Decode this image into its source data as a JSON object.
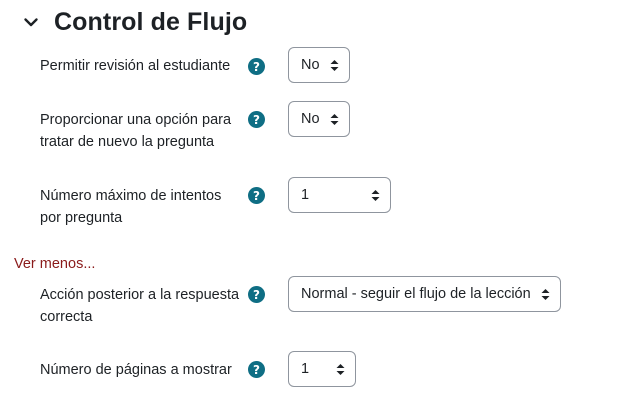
{
  "section": {
    "title": "Control de Flujo",
    "collapse_icon": "chevron-down-icon"
  },
  "fields": [
    {
      "label": "Permitir revisión al estudiante",
      "help_icon": "question-circle-icon",
      "help_glyph": "?",
      "value": "No"
    },
    {
      "label": "Proporcionar una opción para tratar de nuevo la pregunta",
      "help_icon": "question-circle-icon",
      "help_glyph": "?",
      "value": "No"
    },
    {
      "label": "Número máximo de intentos por pregunta",
      "help_icon": "question-circle-icon",
      "help_glyph": "?",
      "value": "1"
    },
    {
      "label": "Acción posterior a la respuesta correcta",
      "help_icon": "question-circle-icon",
      "help_glyph": "?",
      "value": "Normal - seguir el flujo de la lección"
    },
    {
      "label": "Número de páginas a mostrar",
      "help_icon": "question-circle-icon",
      "help_glyph": "?",
      "value": "1"
    }
  ],
  "show_less_link": "Ver menos...",
  "colors": {
    "help_badge": "#0f6e84",
    "link": "#8a1a1a",
    "text": "#1d2125",
    "border": "#8f959e"
  }
}
